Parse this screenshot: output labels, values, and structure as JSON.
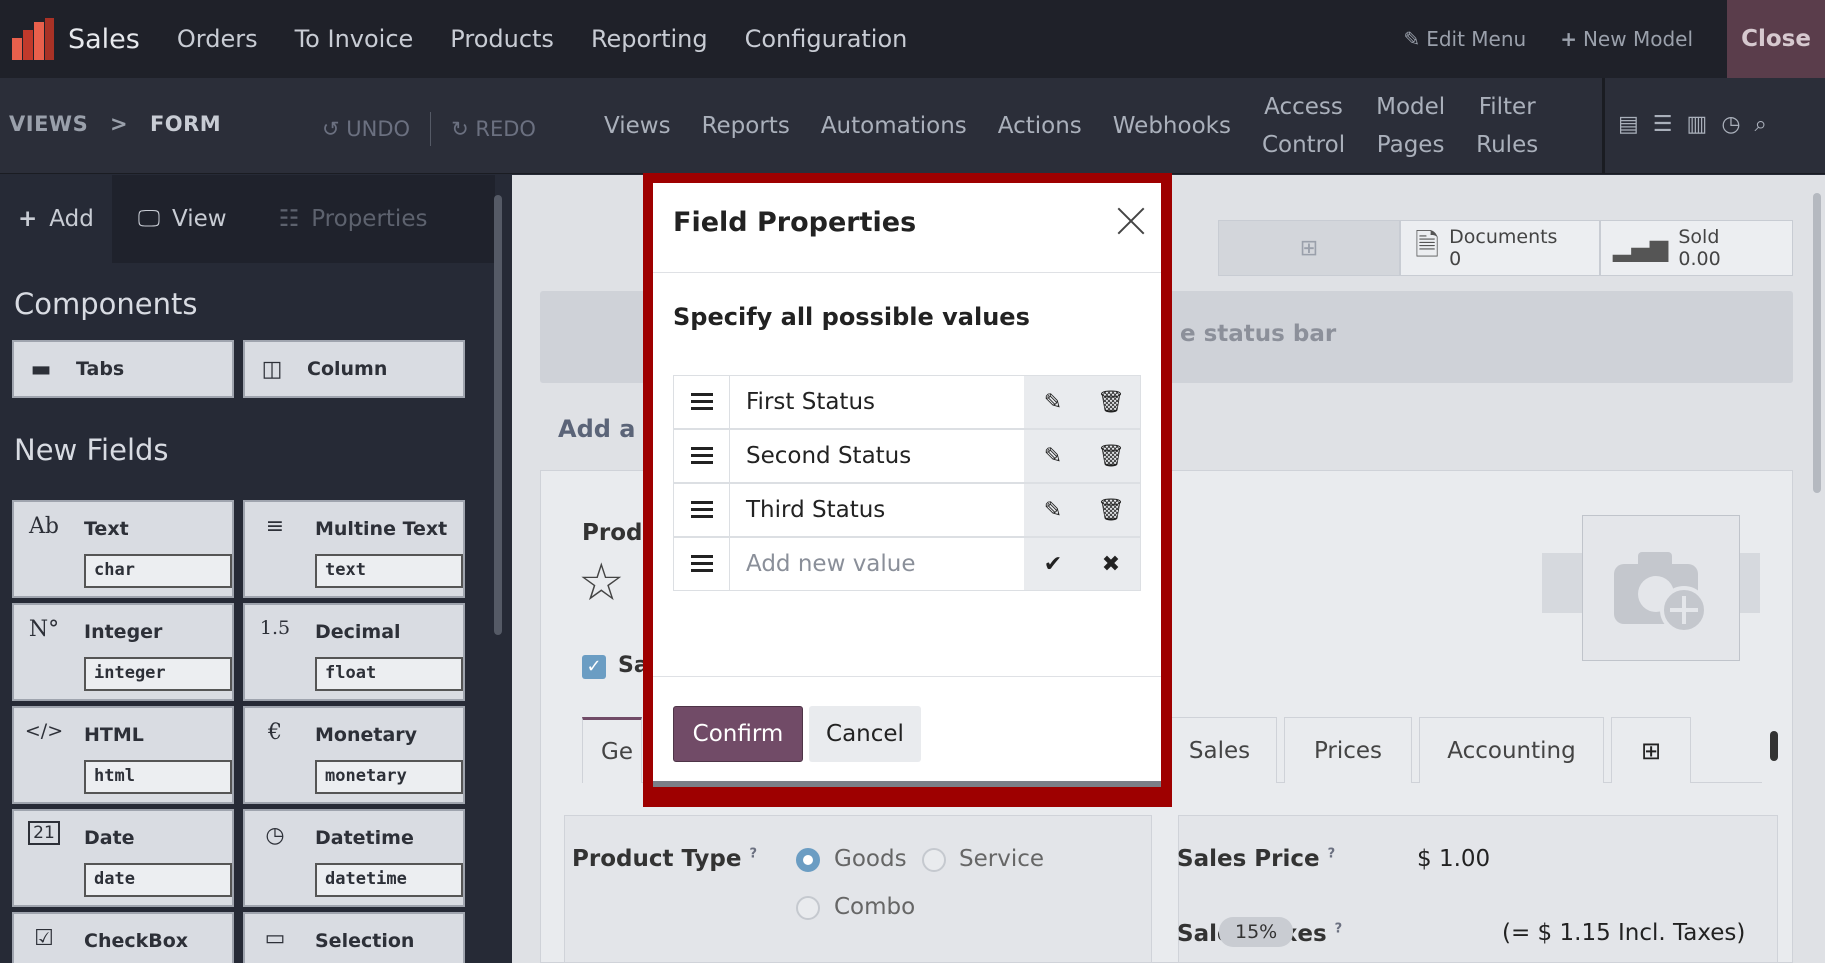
{
  "topbar": {
    "app_name": "Sales",
    "menu": [
      "Orders",
      "To Invoice",
      "Products",
      "Reporting",
      "Configuration"
    ],
    "edit_menu": "Edit Menu",
    "new_model": "New Model",
    "close": "Close"
  },
  "subbar": {
    "crumb_views": "VIEWS",
    "crumb_sep": ">",
    "crumb_form": "FORM",
    "undo": "UNDO",
    "redo": "REDO",
    "menu": [
      "Views",
      "Reports",
      "Automations",
      "Actions",
      "Webhooks"
    ],
    "access_control": [
      "Access",
      "Control"
    ],
    "model_pages": [
      "Model",
      "Pages"
    ],
    "filter_rules": [
      "Filter",
      "Rules"
    ]
  },
  "left": {
    "tabs": {
      "add": "Add",
      "view": "View",
      "properties": "Properties"
    },
    "components_title": "Components",
    "components": [
      {
        "label": "Tabs",
        "icon": "tabs-icon"
      },
      {
        "label": "Column",
        "icon": "column-icon"
      }
    ],
    "new_fields_title": "New Fields",
    "fields": [
      {
        "label": "Text",
        "tech": "char",
        "icon": "Ab"
      },
      {
        "label": "Multine Text",
        "tech": "text",
        "icon": "≡"
      },
      {
        "label": "Integer",
        "tech": "integer",
        "icon": "N°"
      },
      {
        "label": "Decimal",
        "tech": "float",
        "icon": "1.5"
      },
      {
        "label": "HTML",
        "tech": "html",
        "icon": "</>"
      },
      {
        "label": "Monetary",
        "tech": "monetary",
        "icon": "€"
      },
      {
        "label": "Date",
        "tech": "date",
        "icon": "21"
      },
      {
        "label": "Datetime",
        "tech": "datetime",
        "icon": "◷"
      },
      {
        "label": "CheckBox",
        "icon": "☑"
      },
      {
        "label": "Selection",
        "icon": "▭"
      }
    ]
  },
  "main": {
    "smart": {
      "documents_label": "Documents",
      "documents_count": "0",
      "sold_label": "Sold",
      "sold_value": "0.00"
    },
    "status_hint": "e status bar",
    "add_b": "Add a b",
    "product_label": "Produ",
    "checkbox_label": "Sa",
    "tabs": [
      "Ge",
      "Sales",
      "Prices",
      "Accounting"
    ],
    "product_type_label": "Product Type",
    "product_types": [
      "Goods",
      "Service",
      "Combo"
    ],
    "sales_price_label": "Sales Price",
    "sales_price_value": "$ 1.00",
    "sales_taxes_label": "Sales Taxes",
    "tax_badge": "15%",
    "tax_incl": "(= $ 1.15 Incl. Taxes)",
    "help_mark": "?"
  },
  "modal": {
    "title": "Field Properties",
    "subtitle": "Specify all possible values",
    "values": [
      "First Status",
      "Second Status",
      "Third Status"
    ],
    "new_value_placeholder": "Add new value",
    "confirm": "Confirm",
    "cancel": "Cancel"
  },
  "colors": {
    "brand": "#714b67",
    "highlight": "#9e0000",
    "accent": "#6b9dc3"
  }
}
